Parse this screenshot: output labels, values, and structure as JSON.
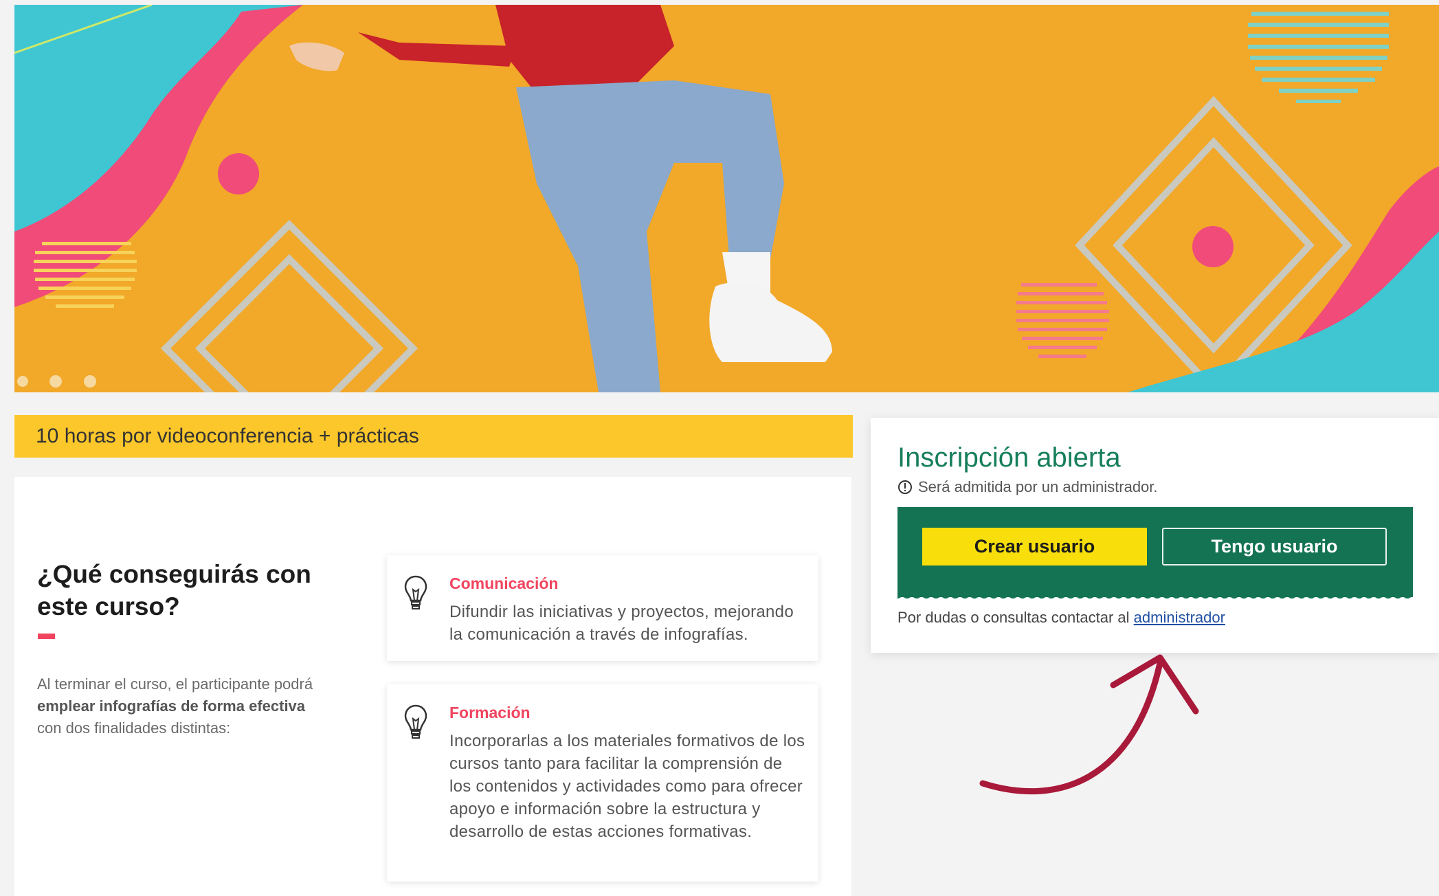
{
  "banner": {
    "image": "hero-banner-jumping-person"
  },
  "course": {
    "duration": "10 horas por videoconferencia + prácticas"
  },
  "section": {
    "title": "¿Qué conseguirás con este curso?",
    "desc_part1": "Al terminar el curso, el participante podrá ",
    "desc_bold": "emplear infografías de forma efectiva",
    "desc_part2": " con dos finalidades distintas:"
  },
  "benefits": [
    {
      "title": "Comunicación",
      "text": "Difundir las iniciativas y proyectos, mejorando la comunicación a través de infografías.",
      "icon": "lightbulb-icon"
    },
    {
      "title": "Formación",
      "text": "Incorporarlas a los materiales formativos de los cursos tanto para facilitar la comprensión de los contenidos y actividades como para ofrecer apoyo e información sobre la estructura y desarrollo de estas acciones formativas.",
      "icon": "lightbulb-icon"
    }
  ],
  "enrollment": {
    "title": "Inscripción abierta",
    "note": "Será admitida por un administrador.",
    "create_label": "Crear usuario",
    "login_label": "Tengo usuario",
    "contact_text": "Por dudas o consultas contactar al ",
    "contact_link": "administrador"
  },
  "colors": {
    "accent_green": "#137352",
    "accent_yellow": "#fcc72b",
    "accent_pink": "#f1455f",
    "title_green": "#167e5b",
    "arrow": "#a8193a"
  }
}
